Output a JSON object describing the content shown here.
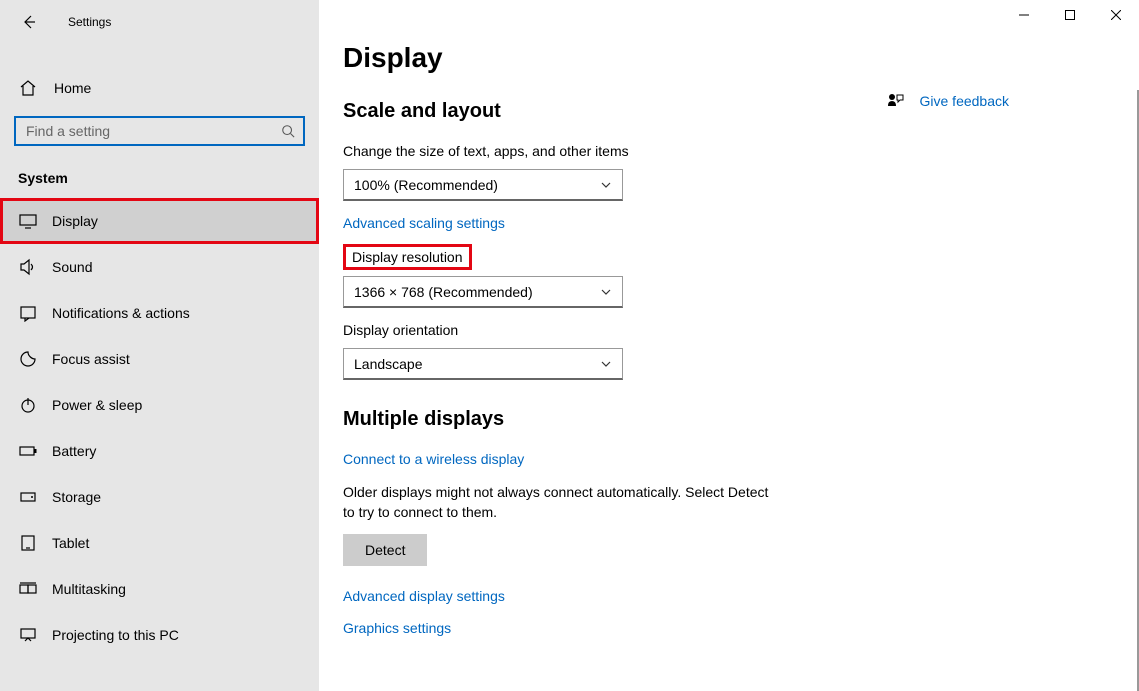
{
  "window": {
    "title": "Settings"
  },
  "sidebar": {
    "home": "Home",
    "searchPlaceholder": "Find a setting",
    "category": "System",
    "items": [
      {
        "label": "Display",
        "icon": "display-icon",
        "selected": true
      },
      {
        "label": "Sound",
        "icon": "sound-icon"
      },
      {
        "label": "Notifications & actions",
        "icon": "notifications-icon"
      },
      {
        "label": "Focus assist",
        "icon": "focus-assist-icon"
      },
      {
        "label": "Power & sleep",
        "icon": "power-icon"
      },
      {
        "label": "Battery",
        "icon": "battery-icon"
      },
      {
        "label": "Storage",
        "icon": "storage-icon"
      },
      {
        "label": "Tablet",
        "icon": "tablet-icon"
      },
      {
        "label": "Multitasking",
        "icon": "multitasking-icon"
      },
      {
        "label": "Projecting to this PC",
        "icon": "projecting-icon"
      }
    ]
  },
  "main": {
    "title": "Display",
    "scaleLayout": {
      "heading": "Scale and layout",
      "textSizeLabel": "Change the size of text, apps, and other items",
      "textSizeValue": "100% (Recommended)",
      "advancedScaling": "Advanced scaling settings",
      "resolutionLabel": "Display resolution",
      "resolutionValue": "1366 × 768 (Recommended)",
      "orientationLabel": "Display orientation",
      "orientationValue": "Landscape"
    },
    "multipleDisplays": {
      "heading": "Multiple displays",
      "connectWireless": "Connect to a wireless display",
      "olderText": "Older displays might not always connect automatically. Select Detect to try to connect to them.",
      "detect": "Detect",
      "advancedDisplay": "Advanced display settings",
      "graphics": "Graphics settings"
    },
    "feedback": "Give feedback"
  }
}
